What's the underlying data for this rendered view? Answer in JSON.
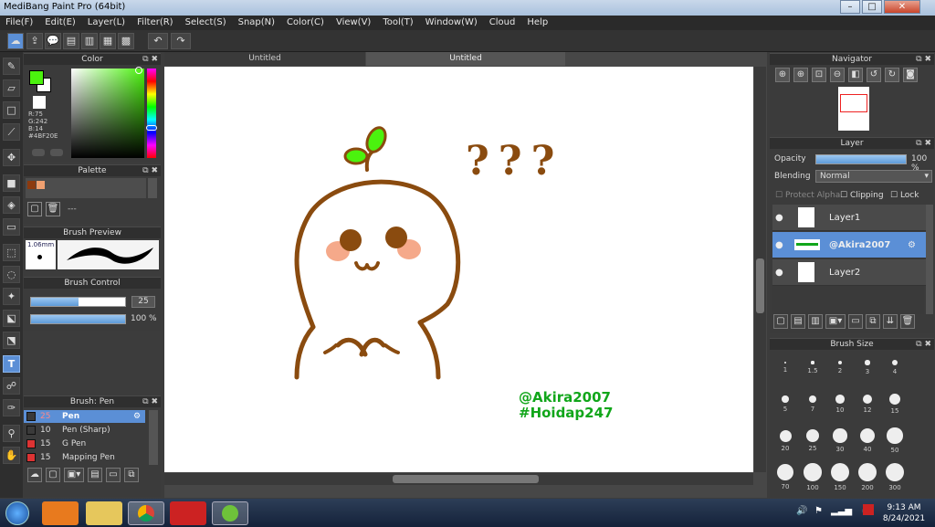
{
  "window": {
    "title": "MediBang Paint Pro (64bit)",
    "min": "–",
    "max": "□",
    "close": "✕"
  },
  "menu": [
    "File(F)",
    "Edit(E)",
    "Layer(L)",
    "Filter(R)",
    "Select(S)",
    "Snap(N)",
    "Color(C)",
    "View(V)",
    "Tool(T)",
    "Window(W)",
    "Cloud",
    "Help"
  ],
  "tabs": {
    "tab1": "Untitled",
    "tab2": "Untitled"
  },
  "color_panel": {
    "title": "Color",
    "rgb": {
      "r": "R:75",
      "g": "G:242",
      "b": "B:14",
      "hex": "#4BF20E"
    },
    "main_color": "#4BF20E"
  },
  "palette_panel": {
    "title": "Palette",
    "sep": "---",
    "colors": [
      "#8c3a0f",
      "#f0a070"
    ]
  },
  "brush_preview": {
    "title": "Brush Preview",
    "size_text": "1.06mm"
  },
  "brush_control": {
    "title": "Brush Control",
    "size_value": "25",
    "opacity_value": "100 %",
    "size_fraction": 0.5,
    "opacity_fraction": 1.0
  },
  "brush_list": {
    "title": "Brush: Pen",
    "items": [
      {
        "size": "25",
        "name": "Pen",
        "color": "#3a3a3a",
        "selected": true
      },
      {
        "size": "10",
        "name": "Pen (Sharp)",
        "color": "#3a3a3a",
        "selected": false
      },
      {
        "size": "15",
        "name": "G Pen",
        "color": "#d33",
        "selected": false
      },
      {
        "size": "15",
        "name": "Mapping Pen",
        "color": "#d33",
        "selected": false
      }
    ]
  },
  "navigator": {
    "title": "Navigator"
  },
  "layer_panel": {
    "title": "Layer",
    "opacity_label": "Opacity",
    "opacity_value": "100 %",
    "blending_label": "Blending",
    "blending_value": "Normal",
    "protect_alpha": "Protect Alpha",
    "clipping": "Clipping",
    "lock": "Lock",
    "layers": [
      {
        "name": "Layer1",
        "selected": false
      },
      {
        "name": "@Akira2007",
        "selected": true
      },
      {
        "name": "Layer2",
        "selected": false
      }
    ]
  },
  "brush_size": {
    "title": "Brush Size",
    "values": [
      "1",
      "1.5",
      "2",
      "3",
      "4",
      "5",
      "7",
      "10",
      "12",
      "15",
      "20",
      "25",
      "30",
      "40",
      "50",
      "70",
      "100",
      "150",
      "200",
      "300"
    ]
  },
  "artwork": {
    "question_marks": "???",
    "signature_line1": "@Akira2007",
    "signature_line2": "#Hoidap247",
    "stroke_color": "#8a4b0f",
    "leaf_color": "#4BF20E",
    "cheek_color": "#f5a98a",
    "signature_color": "#11a61a"
  },
  "taskbar": {
    "time": "9:13 AM",
    "date": "8/24/2021"
  }
}
